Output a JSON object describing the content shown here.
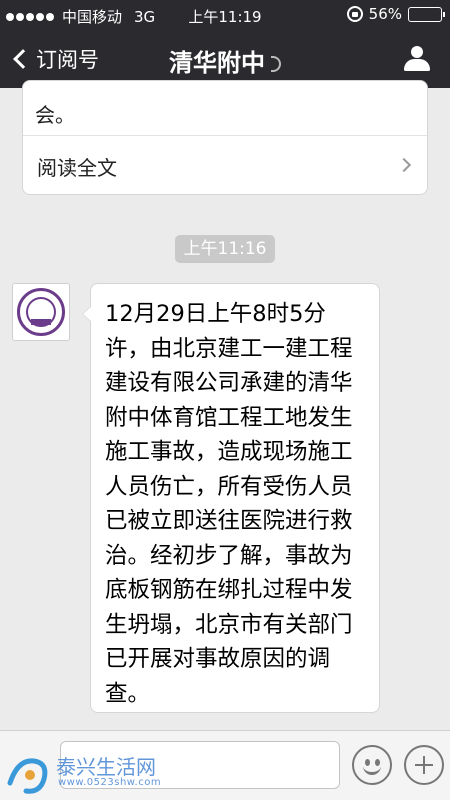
{
  "status_bar": {
    "carrier": "中国移动",
    "network": "3G",
    "time": "上午11:19",
    "battery": "56%",
    "battery_level": 0.56
  },
  "nav": {
    "back_label": "订阅号",
    "title": "清华附中"
  },
  "article_card": {
    "tail_text": "会。",
    "read_more": "阅读全文"
  },
  "timestamp": "上午11:16",
  "message": {
    "text": "12月29日上午8时5分许，由北京建工一建工程建设有限公司承建的清华附中体育馆工程工地发生施工事故，造成现场施工人员伤亡，所有受伤人员已被立即送往医院进行救治。经初步了解，事故为底板钢筋在绑扎过程中发生坍塌，北京市有关部门已开展对事故原因的调查。"
  },
  "watermark": {
    "name": "泰兴生活网",
    "url": "www.0523shw.com"
  },
  "icons": {
    "back": "chevron-left-icon",
    "profile": "person-icon",
    "voice": "voice-icon",
    "emoji": "smiley-icon",
    "add": "plus-icon"
  },
  "colors": {
    "nav_bg": "#2b2b2f",
    "chat_bg": "#ebebeb",
    "bubble_bg": "#ffffff",
    "seal": "#6b3c8a"
  }
}
